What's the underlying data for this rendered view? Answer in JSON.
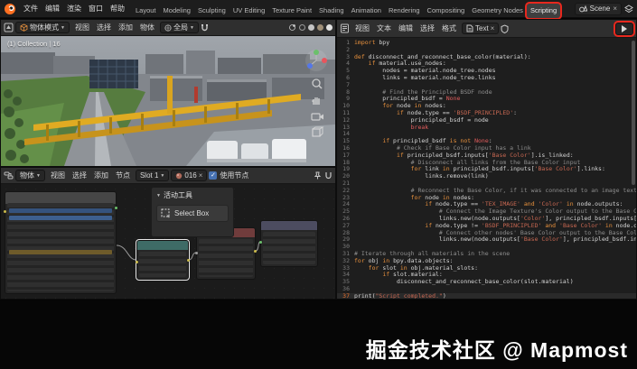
{
  "topbar": {
    "app_menus": [
      "文件",
      "编辑",
      "渲染",
      "窗口",
      "帮助"
    ],
    "tabs": [
      "Layout",
      "Modeling",
      "Sculpting",
      "UV Editing",
      "Texture Paint",
      "Shading",
      "Animation",
      "Rendering",
      "Compositing",
      "Geometry Nodes",
      "Scripting"
    ],
    "active_tab": "Scripting",
    "scene_selector": "Scene"
  },
  "viewport": {
    "mode": "物体模式",
    "menus": [
      "视图",
      "选择",
      "添加",
      "物体"
    ],
    "orientation": "全局",
    "collection_info": "(1) Collection | 16"
  },
  "node_editor": {
    "shader_type": "物体",
    "menus": [
      "视图",
      "选择",
      "添加",
      "节点"
    ],
    "slot": "Slot 1",
    "material_name": "016",
    "use_nodes_label": "使用节点",
    "tool_panel": {
      "title": "活动工具",
      "tool": "Select Box"
    }
  },
  "text_editor": {
    "menus": [
      "视图",
      "文本",
      "编辑",
      "选择",
      "格式"
    ],
    "datablock": "Text",
    "current_line": 37,
    "code": [
      {
        "n": 1,
        "parts": [
          [
            "k",
            "import"
          ],
          [
            "p",
            " bpy"
          ]
        ]
      },
      {
        "n": 2,
        "parts": []
      },
      {
        "n": 3,
        "parts": [
          [
            "k",
            "def"
          ],
          [
            "p",
            " disconnect_and_reconnect_base_color(material):"
          ]
        ]
      },
      {
        "n": 4,
        "parts": [
          [
            "p",
            "    "
          ],
          [
            "k",
            "if"
          ],
          [
            "p",
            " material.use_nodes:"
          ]
        ]
      },
      {
        "n": 5,
        "parts": [
          [
            "p",
            "        nodes = material.node_tree.nodes"
          ]
        ]
      },
      {
        "n": 6,
        "parts": [
          [
            "p",
            "        links = material.node_tree.links"
          ]
        ]
      },
      {
        "n": 7,
        "parts": []
      },
      {
        "n": 8,
        "parts": [
          [
            "c",
            "        # Find the Principled BSDF node"
          ]
        ]
      },
      {
        "n": 9,
        "parts": [
          [
            "p",
            "        principled_bsdf = "
          ],
          [
            "n",
            "None"
          ]
        ]
      },
      {
        "n": 10,
        "parts": [
          [
            "p",
            "        "
          ],
          [
            "k",
            "for"
          ],
          [
            "p",
            " node "
          ],
          [
            "k",
            "in"
          ],
          [
            "p",
            " nodes:"
          ]
        ]
      },
      {
        "n": 11,
        "parts": [
          [
            "p",
            "            "
          ],
          [
            "k",
            "if"
          ],
          [
            "p",
            " node.type == "
          ],
          [
            "s",
            "'BSDF_PRINCIPLED'"
          ],
          [
            "p",
            ":"
          ]
        ]
      },
      {
        "n": 12,
        "parts": [
          [
            "p",
            "                principled_bsdf = node"
          ]
        ]
      },
      {
        "n": 13,
        "parts": [
          [
            "p",
            "                "
          ],
          [
            "n",
            "break"
          ]
        ]
      },
      {
        "n": 14,
        "parts": []
      },
      {
        "n": 15,
        "parts": [
          [
            "p",
            "        "
          ],
          [
            "k",
            "if"
          ],
          [
            "p",
            " principled_bsdf "
          ],
          [
            "k",
            "is"
          ],
          [
            "p",
            " "
          ],
          [
            "k",
            "not"
          ],
          [
            "p",
            " "
          ],
          [
            "n",
            "None"
          ],
          [
            "p",
            ":"
          ]
        ]
      },
      {
        "n": 16,
        "parts": [
          [
            "c",
            "            # Check if Base Color input has a link"
          ]
        ]
      },
      {
        "n": 17,
        "parts": [
          [
            "p",
            "            "
          ],
          [
            "k",
            "if"
          ],
          [
            "p",
            " principled_bsdf.inputs["
          ],
          [
            "s",
            "'Base Color'"
          ],
          [
            "p",
            "].is_linked:"
          ]
        ]
      },
      {
        "n": 18,
        "parts": [
          [
            "c",
            "                # Disconnect all links from the Base Color input"
          ]
        ]
      },
      {
        "n": 19,
        "parts": [
          [
            "p",
            "                "
          ],
          [
            "k",
            "for"
          ],
          [
            "p",
            " link "
          ],
          [
            "k",
            "in"
          ],
          [
            "p",
            " principled_bsdf.inputs["
          ],
          [
            "s",
            "'Base Color'"
          ],
          [
            "p",
            "].links:"
          ]
        ]
      },
      {
        "n": 20,
        "parts": [
          [
            "p",
            "                    links.remove(link)"
          ]
        ]
      },
      {
        "n": 21,
        "parts": []
      },
      {
        "n": 22,
        "parts": [
          [
            "c",
            "                # Reconnect the Base Color, if it was connected to an image texture or another no"
          ]
        ]
      },
      {
        "n": 23,
        "parts": [
          [
            "p",
            "                "
          ],
          [
            "k",
            "for"
          ],
          [
            "p",
            " node "
          ],
          [
            "k",
            "in"
          ],
          [
            "p",
            " nodes:"
          ]
        ]
      },
      {
        "n": 24,
        "parts": [
          [
            "p",
            "                    "
          ],
          [
            "k",
            "if"
          ],
          [
            "p",
            " node.type == "
          ],
          [
            "s",
            "'TEX_IMAGE'"
          ],
          [
            "p",
            " "
          ],
          [
            "k",
            "and"
          ],
          [
            "p",
            " "
          ],
          [
            "s",
            "'Color'"
          ],
          [
            "p",
            " "
          ],
          [
            "k",
            "in"
          ],
          [
            "p",
            " node.outputs:"
          ]
        ]
      },
      {
        "n": 25,
        "parts": [
          [
            "c",
            "                        # Connect the Image Texture's Color output to the Base Color of the Princ"
          ]
        ]
      },
      {
        "n": 26,
        "parts": [
          [
            "p",
            "                        links.new(node.outputs["
          ],
          [
            "s",
            "'Color'"
          ],
          [
            "p",
            "], principled_bsdf.inputs["
          ],
          [
            "s",
            "'Base Color'"
          ],
          [
            "p",
            "])"
          ]
        ]
      },
      {
        "n": 27,
        "parts": [
          [
            "p",
            "                    "
          ],
          [
            "k",
            "if"
          ],
          [
            "p",
            " node.type != "
          ],
          [
            "s",
            "'BSDF_PRINCIPLED'"
          ],
          [
            "p",
            " "
          ],
          [
            "k",
            "and"
          ],
          [
            "p",
            " "
          ],
          [
            "s",
            "'Base Color'"
          ],
          [
            "p",
            " "
          ],
          [
            "k",
            "in"
          ],
          [
            "p",
            " node.outputs:"
          ]
        ]
      },
      {
        "n": 28,
        "parts": [
          [
            "c",
            "                        # Connect other nodes' Base Color output to the Base Color of the Principl"
          ]
        ]
      },
      {
        "n": 29,
        "parts": [
          [
            "p",
            "                        links.new(node.outputs["
          ],
          [
            "s",
            "'Base Color'"
          ],
          [
            "p",
            "], principled_bsdf.inputs["
          ],
          [
            "s",
            "'Base Color'"
          ],
          [
            "p",
            "])"
          ]
        ]
      },
      {
        "n": 30,
        "parts": []
      },
      {
        "n": 31,
        "parts": [
          [
            "c",
            "# Iterate through all materials in the scene"
          ]
        ]
      },
      {
        "n": 32,
        "parts": [
          [
            "k",
            "for"
          ],
          [
            "p",
            " obj "
          ],
          [
            "k",
            "in"
          ],
          [
            "p",
            " bpy.data.objects:"
          ]
        ]
      },
      {
        "n": 33,
        "parts": [
          [
            "p",
            "    "
          ],
          [
            "k",
            "for"
          ],
          [
            "p",
            " slot "
          ],
          [
            "k",
            "in"
          ],
          [
            "p",
            " obj.material_slots:"
          ]
        ]
      },
      {
        "n": 34,
        "parts": [
          [
            "p",
            "        "
          ],
          [
            "k",
            "if"
          ],
          [
            "p",
            " slot.material:"
          ]
        ]
      },
      {
        "n": 35,
        "parts": [
          [
            "p",
            "            disconnect_and_reconnect_base_color(slot.material)"
          ]
        ]
      },
      {
        "n": 36,
        "parts": []
      },
      {
        "n": 37,
        "parts": [
          [
            "p",
            "print("
          ],
          [
            "s",
            "\"Script completed.\""
          ],
          [
            "p",
            ")"
          ]
        ]
      }
    ]
  },
  "watermark": "掘金技术社区 @ Mapmost",
  "colors": {
    "annotation": "#e8281e",
    "syntax_keyword": "#e8913d",
    "syntax_string": "#c96852",
    "syntax_comment": "#8e8e8e",
    "syntax_constant": "#e35d5d",
    "syntax_plain": "#d6d6d6",
    "editor_bg": "#1e1e1e",
    "header_bg": "#2f2f2f",
    "topbar_bg": "#1d1d1d"
  }
}
